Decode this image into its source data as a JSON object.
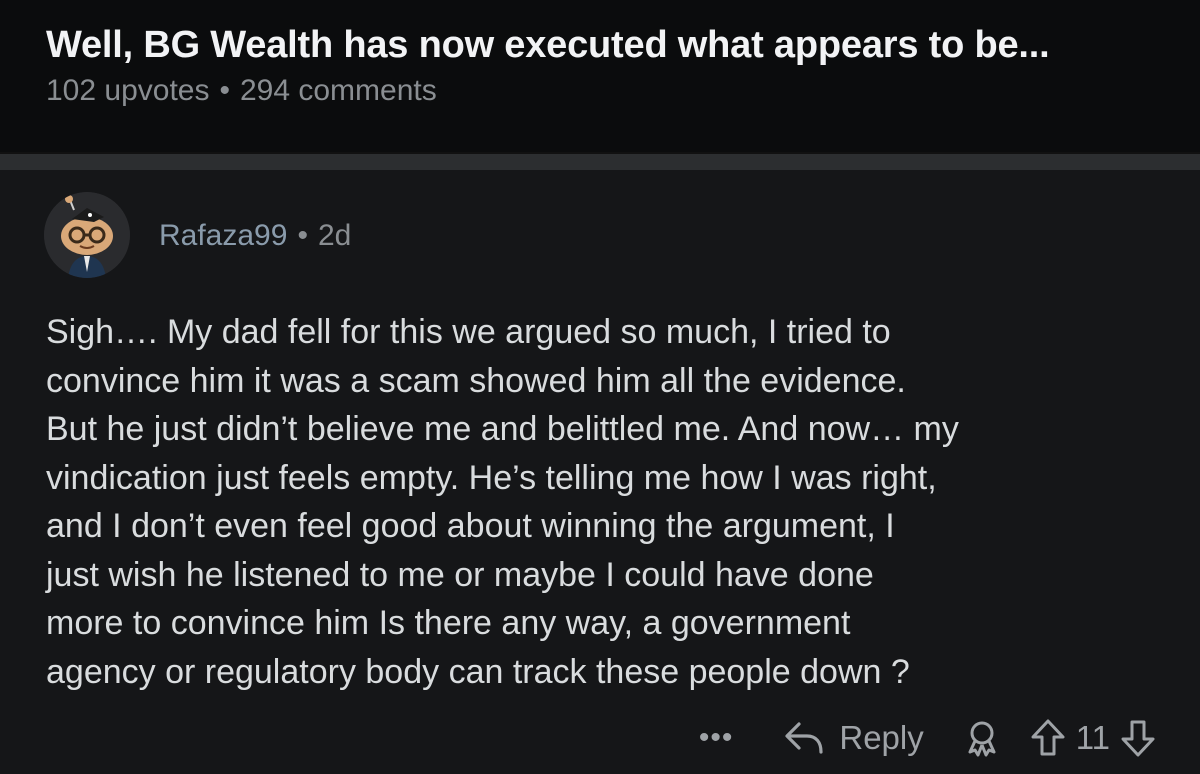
{
  "post": {
    "title": "Well, BG Wealth has now executed what appears to be...",
    "upvotes": "102 upvotes",
    "separator": "•",
    "comments": "294 comments"
  },
  "comment": {
    "author": "Rafaza99",
    "separator": "•",
    "age": "2d",
    "body_lines": [
      "Sigh…. My dad fell for this we argued so much, I tried to",
      "convince him it was a scam showed him all the evidence.",
      "But he just didn’t believe me and belittled me. And now… my",
      "vindication just feels empty. He’s telling me how I was right,",
      "and I don’t even feel good about winning the argument, I",
      "just wish he listened to me or maybe I could have done",
      "more to convince him Is there any way, a government",
      "agency or regulatory body can track these people down ?"
    ],
    "actions": {
      "more": "•••",
      "reply_label": "Reply",
      "score": "11"
    }
  },
  "icons": {
    "avatar": "snoo-avatar-icon",
    "more": "more-options-icon",
    "reply": "reply-arrow-icon",
    "award": "award-icon",
    "upvote": "upvote-arrow-icon",
    "downvote": "downvote-arrow-icon"
  },
  "colors": {
    "background": "#0b0c0d",
    "comment_background": "#151618",
    "divider": "#2c2e30",
    "title": "#f2f3f5",
    "meta": "#8a8e92",
    "author": "#8a9bab",
    "body_text": "#d9dcde"
  }
}
